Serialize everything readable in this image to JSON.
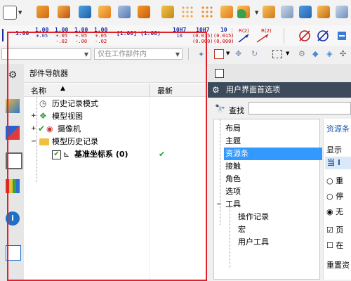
{
  "toolbar2": {
    "tol1": {
      "main": "1.00",
      "upper": "",
      "lower": ""
    },
    "tol2": {
      "main": "1.00",
      "upper": "±.05",
      "lower": ""
    },
    "tol3": {
      "main": "1.00",
      "upper": "+.05",
      "lower": "-.02"
    },
    "tol4": {
      "main": "1.00",
      "upper": "+.05",
      "lower": "-.00"
    },
    "tol5": {
      "main": "1.00",
      "upper": "+.05",
      "lower": "-.02"
    },
    "tol6": {
      "main": "[1.00]",
      "upper": "",
      "lower": ""
    },
    "tol7": {
      "main": "(1.00)",
      "upper": "",
      "lower": ""
    },
    "tol8": {
      "main": "10H7",
      "upper": "",
      "lower": "10"
    },
    "tol9": {
      "main": "10H7",
      "upper": "(0.015)",
      "lower": "(0.000)"
    },
    "tol10": {
      "main": "10",
      "upper": "(0.015)",
      "lower": "(0.000)"
    },
    "rad1": "R(2)",
    "rad2": "R(2)"
  },
  "toolbar3": {
    "filter_value": "",
    "scope_value": "仅在工作部件内"
  },
  "navigator": {
    "title": "部件导航器",
    "col_name": "名称",
    "col_latest": "最新",
    "items": [
      {
        "label": "历史记录模式"
      },
      {
        "label": "模型视图"
      },
      {
        "label": "摄像机"
      },
      {
        "label": "模型历史记录"
      },
      {
        "label": "基准坐标系 (0)"
      }
    ]
  },
  "dialog": {
    "tab_label": "",
    "title": "用户界面首选项",
    "search_label": "查找",
    "tree": [
      {
        "label": "布局"
      },
      {
        "label": "主题"
      },
      {
        "label": "资源条"
      },
      {
        "label": "接触"
      },
      {
        "label": "角色"
      },
      {
        "label": "选项"
      },
      {
        "label": "工具"
      },
      {
        "label": "操作记录"
      },
      {
        "label": "宏"
      },
      {
        "label": "用户工具"
      }
    ],
    "panel": {
      "section": "资源条",
      "display_label": "显示",
      "current": "当 I",
      "opt1": "重",
      "opt2": "停",
      "opt3": "无",
      "check1": "页",
      "check2": "在",
      "reset": "重置资"
    }
  },
  "colors": {
    "highlight": "#e0202b",
    "selection": "#3399ff",
    "dialog_titlebar": "#3c4a5b"
  }
}
